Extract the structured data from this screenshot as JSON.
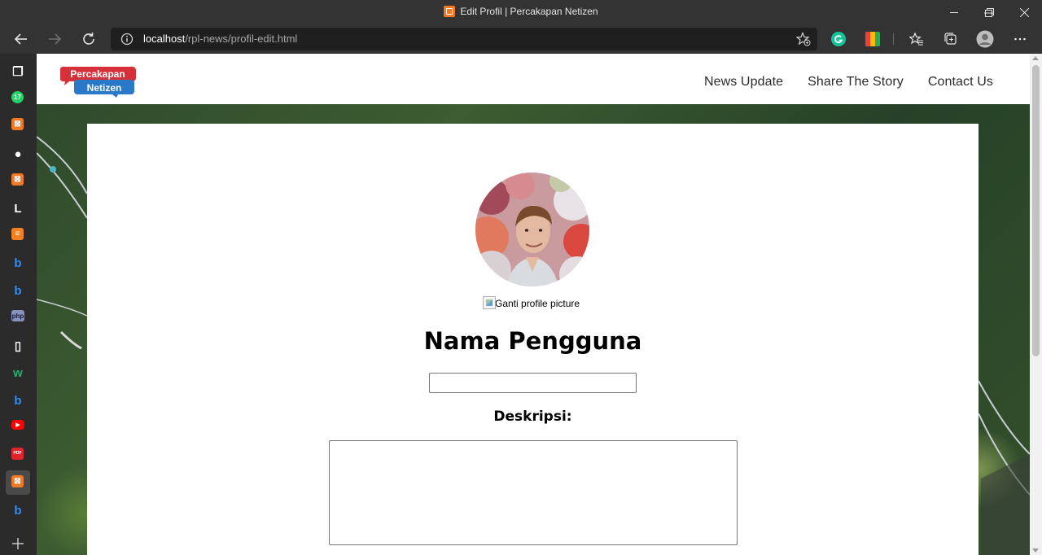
{
  "window": {
    "title": "Edit Profil | Percakapan Netizen"
  },
  "address_bar": {
    "host": "localhost",
    "path": "/rpl-news/profil-edit.html"
  },
  "sidebar_tabs": [
    {
      "icon": "tab-actions-icon",
      "color": "#ffffff"
    },
    {
      "icon": "whatsapp-icon",
      "color": "#25d366",
      "badge": "17"
    },
    {
      "icon": "xampp-icon",
      "color": "#f07a24"
    },
    {
      "icon": "github-icon",
      "color": "#ffffff"
    },
    {
      "icon": "xampp-icon",
      "color": "#f07a24"
    },
    {
      "icon": "letter-l-icon",
      "color": "#ffffff"
    },
    {
      "icon": "stackoverflow-icon",
      "color": "#f48024"
    },
    {
      "icon": "bing-icon",
      "color": "#2f8ef5"
    },
    {
      "icon": "bing-icon",
      "color": "#2f8ef5"
    },
    {
      "icon": "php-icon",
      "color": "#8892bf",
      "label": "php"
    },
    {
      "icon": "page-icon",
      "color": "#ffffff"
    },
    {
      "icon": "wattpad-icon",
      "color": "#1fb36a"
    },
    {
      "icon": "bing-icon",
      "color": "#2f8ef5"
    },
    {
      "icon": "youtube-icon",
      "color": "#ff0000"
    },
    {
      "icon": "pdf-icon",
      "color": "#e0242a"
    },
    {
      "icon": "xampp-icon",
      "color": "#f07a24",
      "active": true
    },
    {
      "icon": "bing-icon",
      "color": "#2f8ef5"
    }
  ],
  "site": {
    "logo_line1": "Percakapan",
    "logo_line2": "Netizen",
    "nav": [
      "News Update",
      "Share The Story",
      "Contact Us"
    ]
  },
  "profile": {
    "change_picture_alt": "Ganti profile picture",
    "username": "Nama Pengguna",
    "name_input_value": "",
    "description_label": "Deskripsi:",
    "description_value": ""
  },
  "colors": {
    "chrome_bg": "#333333",
    "logo_red": "#d6303a",
    "logo_blue": "#2a79c9"
  }
}
